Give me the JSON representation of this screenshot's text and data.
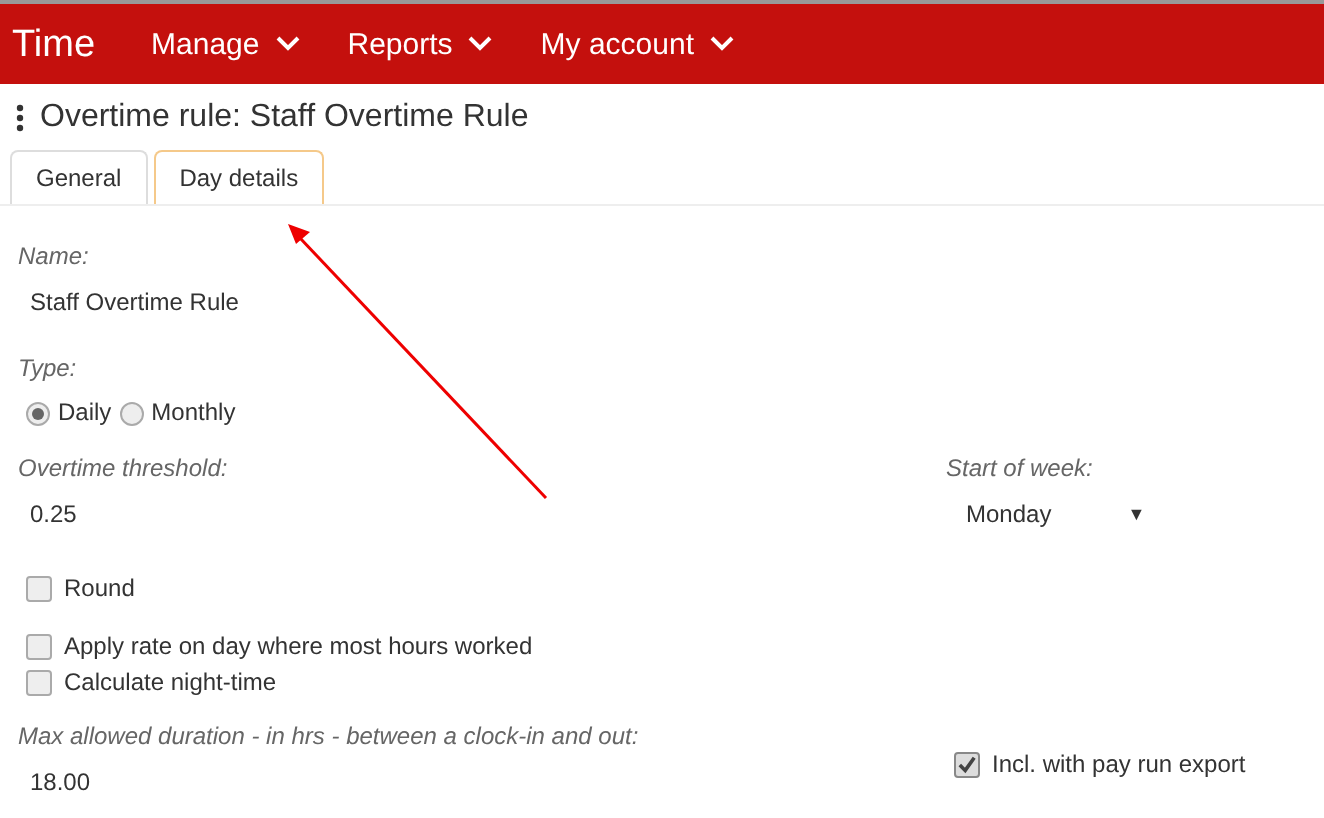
{
  "nav": {
    "brand": "Time",
    "menus": [
      {
        "label": "Manage"
      },
      {
        "label": "Reports"
      },
      {
        "label": "My account"
      }
    ]
  },
  "title": "Overtime rule: Staff Overtime Rule",
  "tabs": [
    {
      "label": "General",
      "selected": false
    },
    {
      "label": "Day details",
      "selected": true
    }
  ],
  "name": {
    "label": "Name:",
    "value": "Staff Overtime Rule"
  },
  "type": {
    "label": "Type:",
    "options": [
      {
        "label": "Daily",
        "selected": true
      },
      {
        "label": "Monthly",
        "selected": false
      }
    ]
  },
  "threshold": {
    "label": "Overtime threshold:",
    "value": "0.25"
  },
  "start_of_week": {
    "label": "Start of week:",
    "value": "Monday",
    "caret": "▼"
  },
  "options": [
    {
      "label": "Round",
      "checked": false
    },
    {
      "label": "Apply rate on day where most hours worked",
      "checked": false
    },
    {
      "label": "Calculate night-time",
      "checked": false
    }
  ],
  "max_duration": {
    "label": "Max allowed duration - in hrs - between a clock-in and out:",
    "value": "18.00"
  },
  "export": {
    "label": "Incl. with pay run export",
    "checked": true
  }
}
